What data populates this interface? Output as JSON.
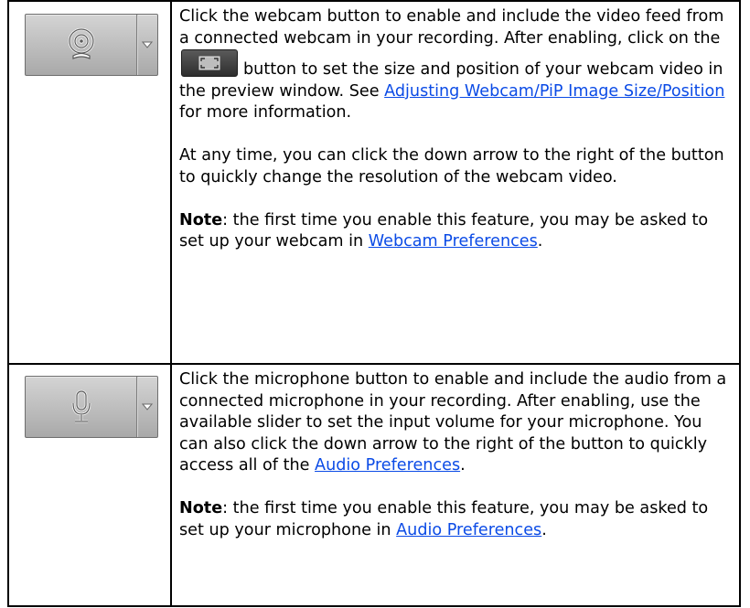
{
  "rows": [
    {
      "button": {
        "icon": "webcam-icon",
        "arrow_icon": "chevron-down-icon"
      },
      "para1": {
        "part1": "Click the webcam button to enable and include the video feed from a connected webcam in your recording. After enabling, click on the",
        "inline_icon": "fit-frame-icon",
        "part2": "button to set the size and position of your webcam video in the preview window. See",
        "link": "Adjusting Webcam/PiP Image Size/Position",
        "part3": "for more information."
      },
      "para2": "At any time, you can click the down arrow to the right of the button to quickly change the resolution of the webcam video.",
      "note": {
        "label": "Note",
        "text": ": the first time you enable this feature, you may be asked to set up your webcam in",
        "link": "Webcam Preferences",
        "end": "."
      }
    },
    {
      "button": {
        "icon": "microphone-icon",
        "arrow_icon": "chevron-down-icon"
      },
      "para1": {
        "text": "Click the microphone button to enable and include the audio from a connected microphone in your recording. After enabling, use the available slider to set the input volume for your microphone. You can also click the down arrow to the right of the button to quickly access all of the",
        "link": "Audio Preferences",
        "end": "."
      },
      "note": {
        "label": "Note",
        "text": ": the first time you enable this feature, you may be asked to set up your microphone in",
        "link": "Audio Preferences",
        "end": "."
      }
    }
  ],
  "colors": {
    "link": "#0b4be6",
    "border": "#000000",
    "button_face": "#bdbdbd"
  }
}
